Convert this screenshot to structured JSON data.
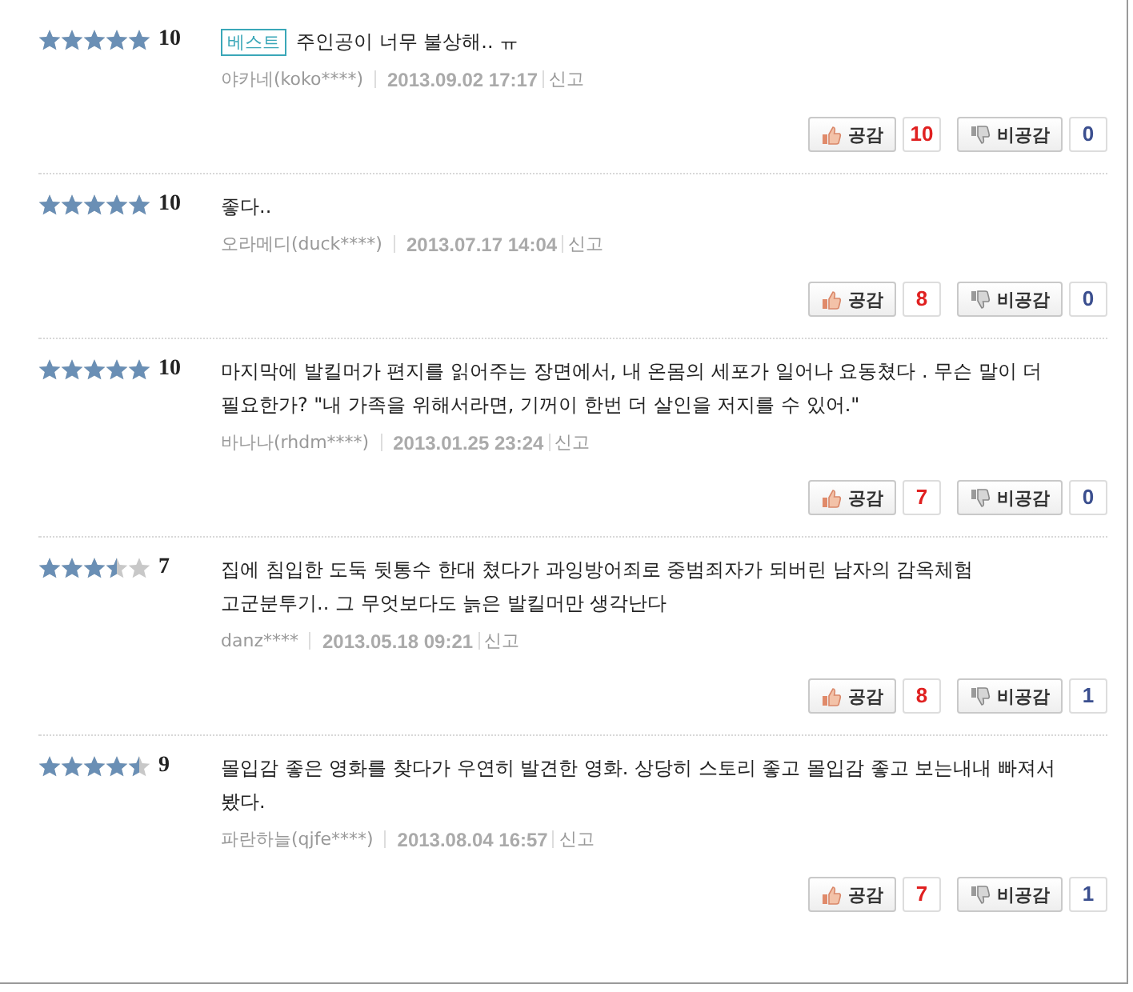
{
  "reviews": [
    {
      "stars": 5,
      "score": "10",
      "badge": "베스트",
      "text": "주인공이 너무 불상해.. ㅠ",
      "author": "야카네(koko****)",
      "date": "2013.09.02 17:17",
      "report": "신고",
      "like_label": "공감",
      "like_count": "10",
      "dislike_label": "비공감",
      "dislike_count": "0"
    },
    {
      "stars": 5,
      "score": "10",
      "text": "좋다..",
      "author": "오라메디(duck****)",
      "date": "2013.07.17 14:04",
      "report": "신고",
      "like_label": "공감",
      "like_count": "8",
      "dislike_label": "비공감",
      "dislike_count": "0"
    },
    {
      "stars": 5,
      "score": "10",
      "text": "마지막에 발킬머가 편지를 읽어주는 장면에서, 내 온몸의 세포가 일어나 요동쳤다 . 무슨 말이 더 필요한가? \"내 가족을 위해서라면, 기꺼이 한번 더 살인을 저지를 수 있어.\"",
      "author": "바나나(rhdm****)",
      "date": "2013.01.25 23:24",
      "report": "신고",
      "like_label": "공감",
      "like_count": "7",
      "dislike_label": "비공감",
      "dislike_count": "0"
    },
    {
      "stars": 3.5,
      "score": "7",
      "text": "집에 침입한 도둑 뒷통수 한대 쳤다가 과잉방어죄로 중범죄자가 되버린 남자의 감옥체험 고군분투기.. 그 무엇보다도 늙은 발킬머만 생각난다",
      "author": "danz****",
      "date": "2013.05.18 09:21",
      "report": "신고",
      "like_label": "공감",
      "like_count": "8",
      "dislike_label": "비공감",
      "dislike_count": "1"
    },
    {
      "stars": 4.5,
      "score": "9",
      "text": "몰입감 좋은 영화를 찾다가 우연히 발견한 영화. 상당히 스토리 좋고 몰입감 좋고 보는내내 빠져서 봤다.",
      "author": "파란하늘(qjfe****)",
      "date": "2013.08.04 16:57",
      "report": "신고",
      "like_label": "공감",
      "like_count": "7",
      "dislike_label": "비공감",
      "dislike_count": "1"
    }
  ]
}
